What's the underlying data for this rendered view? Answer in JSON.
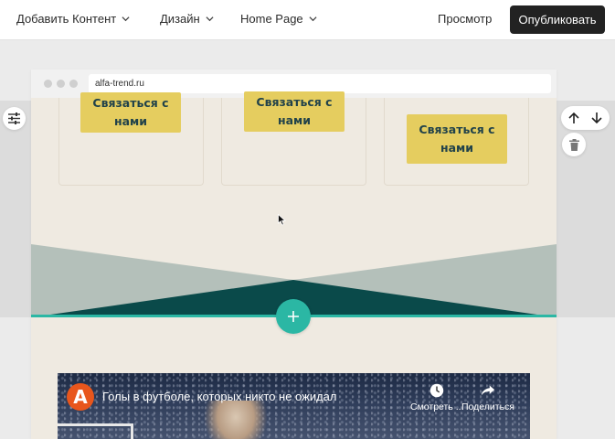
{
  "topbar": {
    "menu": [
      {
        "label": "Добавить Контент"
      },
      {
        "label": "Дизайн"
      },
      {
        "label": "Home Page"
      }
    ],
    "preview_label": "Просмотр",
    "publish_label": "Опубликовать"
  },
  "browser": {
    "url": "alfa-trend.ru"
  },
  "cards": [
    {
      "button_label": "Связаться с нами"
    },
    {
      "button_label": "Связаться с нами"
    },
    {
      "button_label": "Связаться с нами"
    }
  ],
  "video": {
    "channel_letter": "A",
    "title": "Голы в футболе, которых никто не ожидал",
    "watch_later_label": "Смотреть ...",
    "share_label": "Поделиться"
  },
  "colors": {
    "accent": "#2bb7a4",
    "button_yellow": "#e5cd5f",
    "button_text": "#21424a",
    "page_bg": "#efeae1",
    "shape_light": "#b4c0ba",
    "shape_dark": "#0a4a4a",
    "publish_bg": "#222222"
  },
  "icons": {
    "settings": "sliders-icon",
    "move_up": "arrow-up-icon",
    "move_down": "arrow-down-icon",
    "delete": "trash-icon",
    "add": "plus-icon"
  }
}
